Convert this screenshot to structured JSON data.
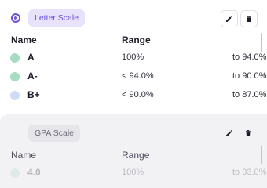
{
  "scales": [
    {
      "name": "Letter Scale",
      "selected": true,
      "columns": {
        "name": "Name",
        "range": "Range"
      },
      "rows": [
        {
          "name": "A",
          "color": "#a6dcc0",
          "from": "100%",
          "to": "to 94.0%"
        },
        {
          "name": "A-",
          "color": "#a6dcc0",
          "from": "< 94.0%",
          "to": "to 90.0%"
        },
        {
          "name": "B+",
          "color": "#cfdcf6",
          "from": "< 90.0%",
          "to": "to 87.0%"
        }
      ]
    },
    {
      "name": "GPA Scale",
      "selected": false,
      "columns": {
        "name": "Name",
        "range": "Range"
      },
      "rows": [
        {
          "name": "4.0",
          "color": "#a6dcc0",
          "from": "100%",
          "to": "to 93.0%"
        }
      ]
    }
  ],
  "icons": {
    "edit": "pencil-icon",
    "delete": "trash-icon",
    "select": "radio-icon"
  },
  "colors": {
    "accent": "#6c4fd6",
    "chip_bg": "#e8e2fb"
  }
}
